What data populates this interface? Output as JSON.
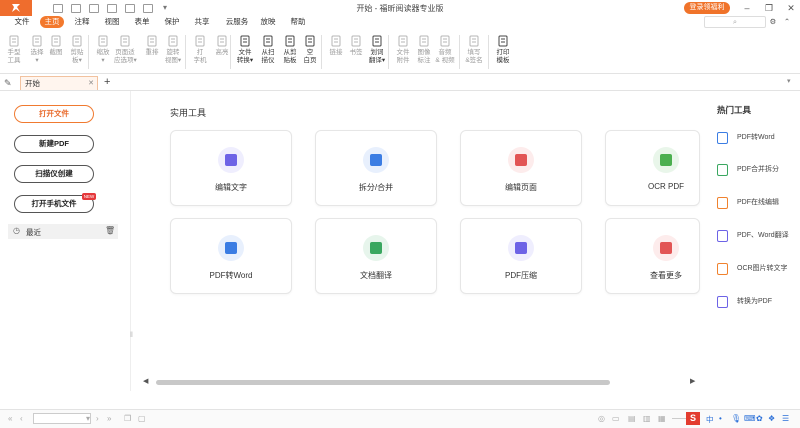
{
  "app": {
    "title": "开始 - 福昕阅读器专业版",
    "login_label": "登录领福利"
  },
  "menu": [
    "文件",
    "主页",
    "注释",
    "视图",
    "表单",
    "保护",
    "共享",
    "云服务",
    "放映",
    "帮助"
  ],
  "ribbon": [
    {
      "label": "手型\n工具",
      "icon": "hand-icon",
      "on": false
    },
    {
      "label": "选择\n▾",
      "icon": "select-cursor-icon",
      "on": false
    },
    {
      "label": "截图",
      "icon": "screenshot-icon",
      "on": false
    },
    {
      "label": "剪贴\n板▾",
      "icon": "clipboard-icon",
      "on": false
    },
    {
      "label": "缩放\n▾",
      "icon": "zoom-icon",
      "on": false
    },
    {
      "label": "页面适\n应选项▾",
      "icon": "fit-page-icon",
      "on": false
    },
    {
      "label": "重排",
      "icon": "reflow-icon",
      "on": false
    },
    {
      "label": "旋转\n视图▾",
      "icon": "rotate-icon",
      "on": false
    },
    {
      "label": "打\n字机",
      "icon": "typewriter-icon",
      "on": false
    },
    {
      "label": "高亮",
      "icon": "highlight-icon",
      "on": false
    },
    {
      "label": "文件\n转换▾",
      "icon": "file-convert-icon",
      "on": true
    },
    {
      "label": "从扫\n描仪",
      "icon": "scanner-icon",
      "on": true
    },
    {
      "label": "从剪\n贴板",
      "icon": "from-clipboard-icon",
      "on": true
    },
    {
      "label": "空\n白页",
      "icon": "blank-page-icon",
      "on": true
    },
    {
      "label": "链接",
      "icon": "link-icon",
      "on": false
    },
    {
      "label": "书签",
      "icon": "bookmark-icon",
      "on": false
    },
    {
      "label": "划词\n翻译▾",
      "icon": "translate-icon",
      "on": true
    },
    {
      "label": "文件\n附件",
      "icon": "attachment-icon",
      "on": false
    },
    {
      "label": "图像\n标注",
      "icon": "image-annotation-icon",
      "on": false
    },
    {
      "label": "音频\n& 视频",
      "icon": "audio-video-icon",
      "on": false
    },
    {
      "label": "填写\n&签名",
      "icon": "fill-sign-icon",
      "on": false
    },
    {
      "label": "打印\n模板",
      "icon": "print-template-icon",
      "on": true
    }
  ],
  "tab": {
    "label": "开始",
    "add": "+"
  },
  "left": {
    "open_file": "打开文件",
    "new_pdf": "新建PDF",
    "scan_create": "扫描仪创建",
    "open_phone": "打开手机文件",
    "new_badge": "NEW",
    "recent": "最近"
  },
  "tools_title": "实用工具",
  "cards": [
    {
      "label": "编辑文字",
      "color": "#6d63e6",
      "bg": "#efeefe"
    },
    {
      "label": "拆分/合并",
      "color": "#3b7de3",
      "bg": "#e8f0fd"
    },
    {
      "label": "编辑页面",
      "color": "#e25555",
      "bg": "#fdecec"
    },
    {
      "label": "OCR PDF",
      "color": "#4caf50",
      "bg": "#e9f6ea"
    },
    {
      "label": "PDF转Word",
      "color": "#3b7de3",
      "bg": "#e8f0fd"
    },
    {
      "label": "文档翻译",
      "color": "#3aa760",
      "bg": "#e7f5ec"
    },
    {
      "label": "PDF压缩",
      "color": "#6d63e6",
      "bg": "#efeefe"
    },
    {
      "label": "查看更多",
      "color": "#e25555",
      "bg": "#fdecec"
    }
  ],
  "hot_title": "热门工具",
  "hot": [
    {
      "label": "PDF转Word",
      "color": "#3b7de3"
    },
    {
      "label": "PDF合并拆分",
      "color": "#3aa760"
    },
    {
      "label": "PDF在线编辑",
      "color": "#f0822e"
    },
    {
      "label": "PDF、Word翻译",
      "color": "#6d63e6"
    },
    {
      "label": "OCR图片转文字",
      "color": "#f0822e"
    },
    {
      "label": "转换为PDF",
      "color": "#6d63e6"
    }
  ]
}
